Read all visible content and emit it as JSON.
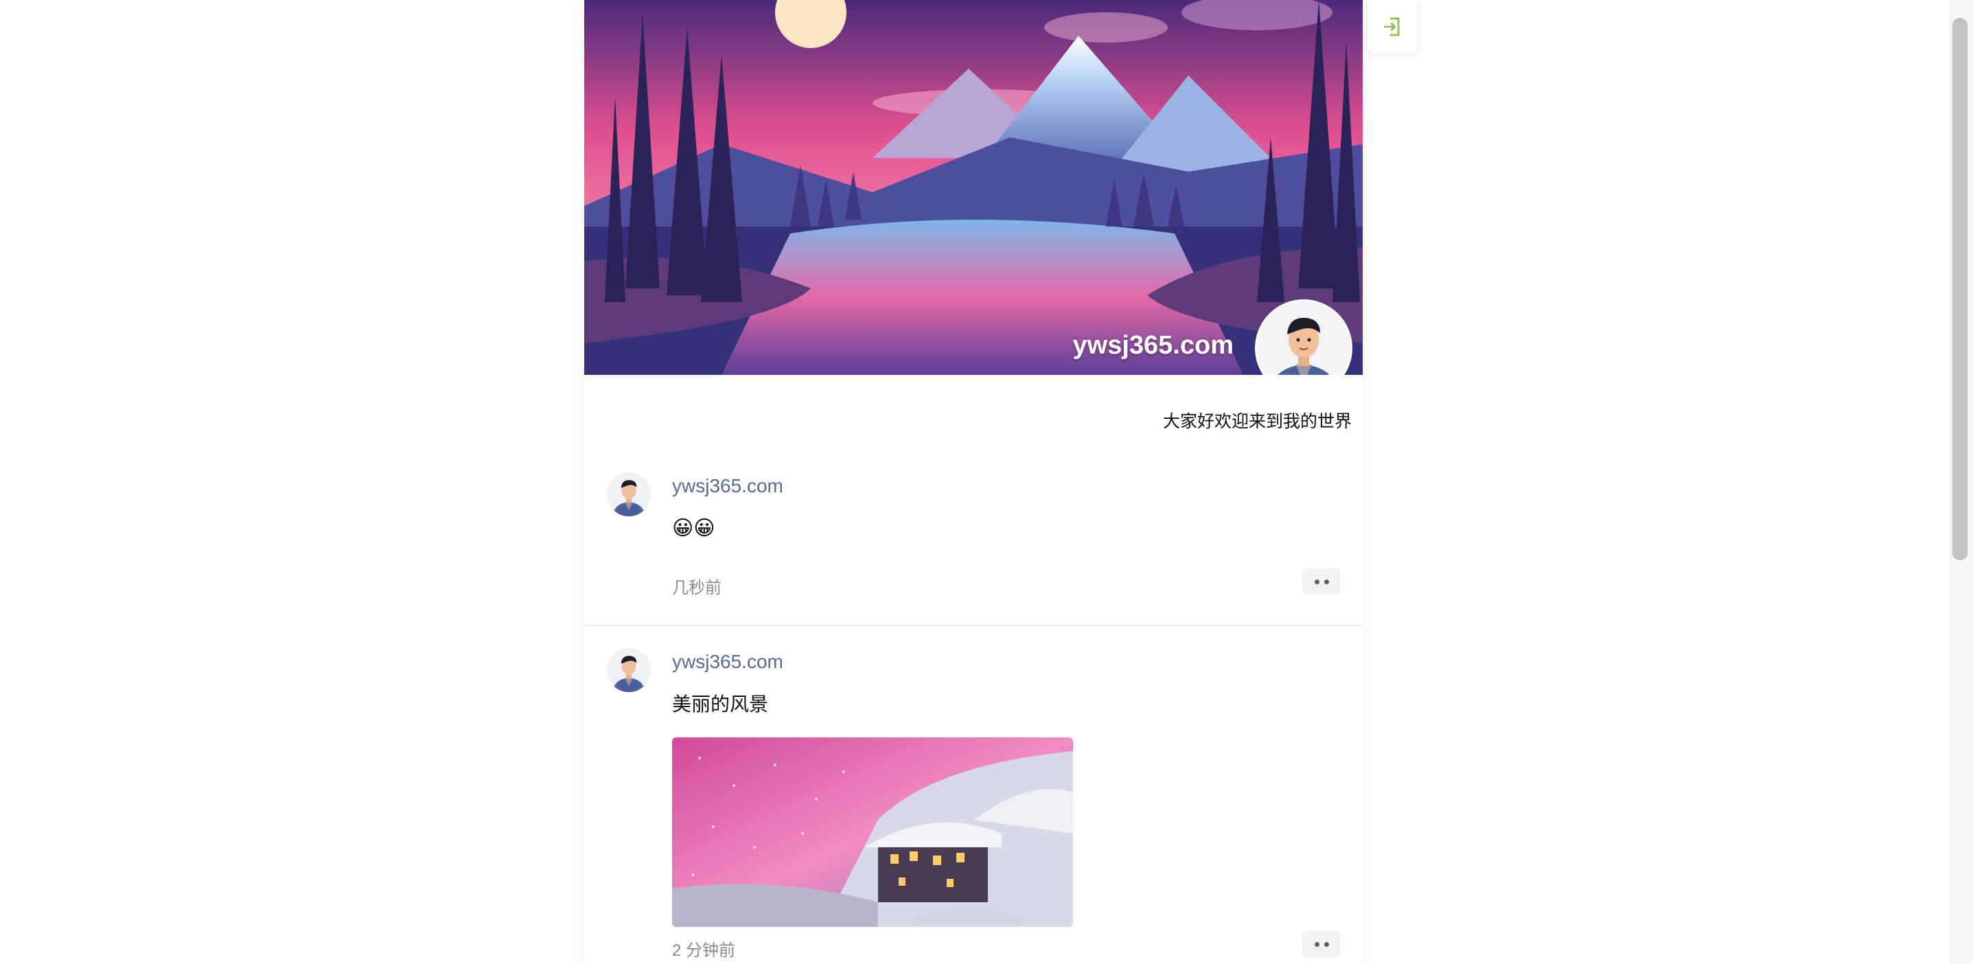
{
  "header": {
    "site_name": "ywsj365.com",
    "bio": "大家好欢迎来到我的世界"
  },
  "login_icon": "login-arrow-icon",
  "posts": [
    {
      "author": "ywsj365.com",
      "text": "😀😀",
      "time": "几秒前",
      "more_icon": "more-dots-icon"
    },
    {
      "author": "ywsj365.com",
      "text": "美丽的风景",
      "time": "2 分钟前",
      "image": "snowy-village-pink-sky",
      "more_icon": "more-dots-icon"
    }
  ],
  "colors": {
    "link": "#576b95",
    "login_icon": "#8bc34a"
  }
}
